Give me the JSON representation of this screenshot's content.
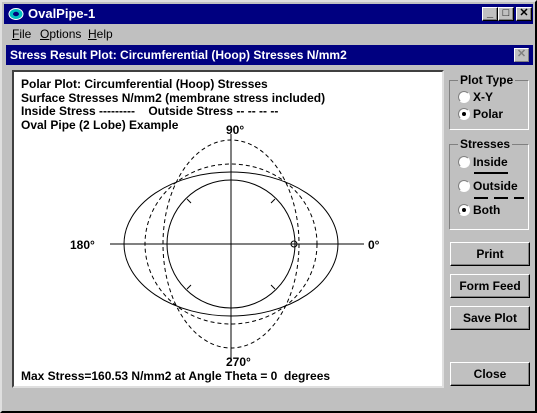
{
  "window": {
    "title": "OvalPipe-1",
    "minimize_glyph": "_",
    "maximize_glyph": "□",
    "close_glyph": "✕"
  },
  "menu": {
    "items": [
      {
        "label": "File",
        "key": "F",
        "rest": "ile"
      },
      {
        "label": "Options",
        "key": "O",
        "rest": "ptions"
      },
      {
        "label": "Help",
        "key": "H",
        "rest": "elp"
      }
    ]
  },
  "dialog": {
    "title": "Stress Result Plot: Circumferential (Hoop) Stresses N/mm2",
    "close_glyph": "✕"
  },
  "plot": {
    "header_lines": [
      "Polar Plot: Circumferential (Hoop) Stresses",
      "Surface Stresses N/mm2 (membrane stress included)",
      "Inside Stress ---------    Outside Stress -- -- -- --",
      "Oval Pipe (2 Lobe) Example"
    ],
    "angle_labels": {
      "top": "90°",
      "bottom": "270°",
      "left": "180°",
      "right": "0°"
    },
    "footer": "Max Stress=160.53 N/mm2 at Angle Theta = 0  degrees"
  },
  "plot_type": {
    "title": "Plot Type",
    "options": [
      "X-Y",
      "Polar"
    ],
    "selected": "Polar"
  },
  "stresses": {
    "title": "Stresses",
    "options": [
      "Inside",
      "Outside",
      "Both"
    ],
    "selected": "Both"
  },
  "buttons": {
    "print": "Print",
    "form_feed": "Form Feed",
    "save_plot": "Save Plot",
    "close": "Close"
  }
}
